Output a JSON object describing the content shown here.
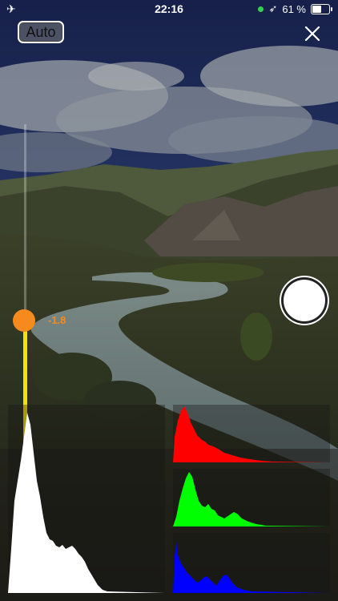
{
  "status_bar": {
    "airplane_icon": "airplane-icon",
    "time": "22:16",
    "battery_percent": "61 %",
    "battery_level": 0.61,
    "location_icon": "location-arrow-icon",
    "indicator_color": "#36d04f"
  },
  "controls": {
    "auto_label": "Auto",
    "close_icon": "close-icon",
    "shutter_icon": "shutter-button"
  },
  "exposure": {
    "value_label": "-1.8",
    "accent_color": "#f58a1f",
    "fill_color": "#f2e205"
  },
  "histograms": {
    "luminance_color": "#ffffff",
    "red_color": "#ff0000",
    "green_color": "#00ff00",
    "blue_color": "#0000ff"
  }
}
